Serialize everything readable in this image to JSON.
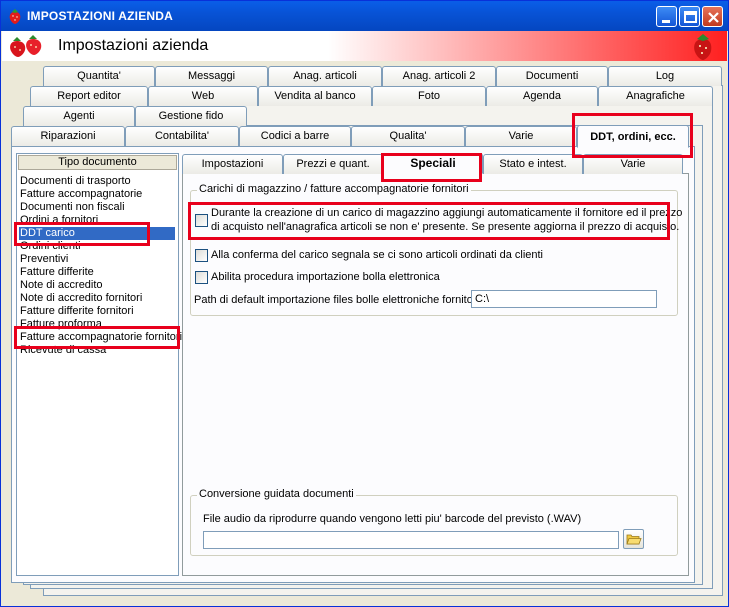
{
  "window": {
    "title": "IMPOSTAZIONI AZIENDA",
    "header": "Impostazioni azienda"
  },
  "top_tabs": {
    "row1": [
      "Quantita'",
      "Messaggi",
      "Anag. articoli",
      "Anag. articoli 2",
      "Documenti",
      "Log"
    ],
    "row2": [
      "Report editor",
      "Web",
      "Vendita al banco",
      "Foto",
      "Agenda",
      "Anagrafiche"
    ],
    "row3": [
      "Agenti",
      "Gestione fido"
    ],
    "row4": [
      "Riparazioni",
      "Contabilita'",
      "Codici a barre",
      "Qualita'",
      "Varie",
      "DDT, ordini, ecc."
    ],
    "active": "DDT, ordini, ecc."
  },
  "doc_list": {
    "header": "Tipo documento",
    "items": [
      "Documenti di trasporto",
      "Fatture accompagnatorie",
      "Documenti non fiscali",
      "Ordini a fornitori",
      "DDT carico",
      "Ordini clienti",
      "Preventivi",
      "Fatture differite",
      "Note di accredito",
      "Note di accredito fornitori",
      "Fatture differite fornitori",
      "Fatture proforma",
      "Fatture accompagnatorie fornitori",
      "Ricevute di cassa"
    ],
    "selected": "DDT carico"
  },
  "inner_tabs": {
    "items": [
      "Impostazioni",
      "Prezzi e quant.",
      "Speciali",
      "Stato e intest.",
      "Varie"
    ],
    "active": "Speciali"
  },
  "group_carichi": {
    "title": "Carichi di magazzino / fatture accompagnatorie fornitori",
    "opt1_line1": "Durante la creazione di un carico di magazzino aggiungi automaticamente il fornitore ed il prezzo",
    "opt1_line2": "di acquisto nell'anagrafica articoli se non e' presente. Se presente aggiorna il prezzo di acquisto.",
    "opt2": "Alla conferma del carico segnala se ci sono articoli ordinati da clienti",
    "opt3": "Abilita procedura importazione bolla elettronica",
    "path_label": "Path di default importazione files bolle elettroniche fornitori",
    "path_value": "C:\\"
  },
  "group_conversione": {
    "title": "Conversione guidata documenti",
    "audio_label": "File audio da riprodurre quando vengono letti piu' barcode del previsto  (.WAV)",
    "audio_value": ""
  },
  "colors": {
    "titlebar": "#0853d6",
    "selection": "#316ac5",
    "highlight_box": "#e8001c",
    "header_gradient_end": "#ff2020"
  }
}
